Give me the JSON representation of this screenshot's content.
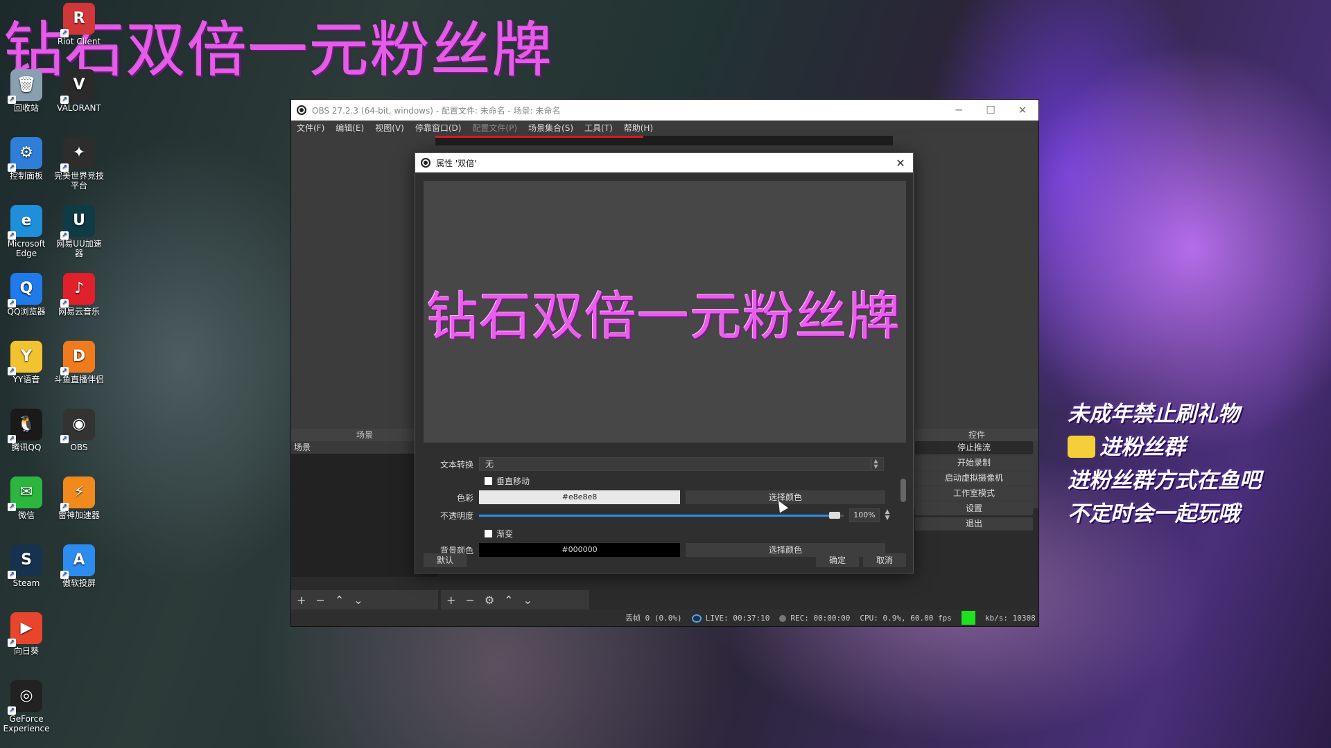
{
  "overlay_title": "钻石双倍一元粉丝牌",
  "desktop": {
    "icons": [
      {
        "label": "Riot Client",
        "icon": "riot-client-icon",
        "color": "#d13639",
        "glyph": "R"
      },
      {
        "label": "回收站",
        "icon": "recycle-bin-icon",
        "color": "#8aa0b0",
        "glyph": "🗑"
      },
      {
        "label": "VALORANT",
        "icon": "valorant-icon",
        "color": "#2a2a2a",
        "glyph": "V"
      },
      {
        "label": "控制面板",
        "icon": "control-panel-icon",
        "color": "#2f7fd8",
        "glyph": "⚙"
      },
      {
        "label": "完美世界竞技平台",
        "icon": "perfect-world-icon",
        "color": "#2d2d2d",
        "glyph": "✦"
      },
      {
        "label": "Microsoft Edge",
        "icon": "edge-icon",
        "color": "#1e8fd8",
        "glyph": "e"
      },
      {
        "label": "网易UU加速器",
        "icon": "uu-accelerator-icon",
        "color": "#0f3b45",
        "glyph": "U"
      },
      {
        "label": "QQ浏览器",
        "icon": "qq-browser-icon",
        "color": "#1f7bea",
        "glyph": "Q"
      },
      {
        "label": "网易云音乐",
        "icon": "netease-music-icon",
        "color": "#e0202b",
        "glyph": "♪"
      },
      {
        "label": "YY语音",
        "icon": "yy-voice-icon",
        "color": "#f2c230",
        "glyph": "Y"
      },
      {
        "label": "斗鱼直播伴侣",
        "icon": "douyu-icon",
        "color": "#f07b1f",
        "glyph": "D"
      },
      {
        "label": "腾讯QQ",
        "icon": "tencent-qq-icon",
        "color": "#1a1a1a",
        "glyph": "🐧"
      },
      {
        "label": "OBS",
        "icon": "obs-icon",
        "color": "#333333",
        "glyph": "◉"
      },
      {
        "label": "微信",
        "icon": "wechat-icon",
        "color": "#2cb53f",
        "glyph": "✉"
      },
      {
        "label": "雷神加速器",
        "icon": "leishen-accelerator-icon",
        "color": "#f08a1c",
        "glyph": "⚡"
      },
      {
        "label": "Steam",
        "icon": "steam-icon",
        "color": "#16324f",
        "glyph": "S"
      },
      {
        "label": "傲软投屏",
        "icon": "apowermirror-icon",
        "color": "#2d8cf0",
        "glyph": "A"
      },
      {
        "label": "向日葵",
        "icon": "sunlogin-icon",
        "color": "#e8452c",
        "glyph": "▶"
      },
      {
        "label": "GeForce Experience",
        "icon": "geforce-icon",
        "color": "#222",
        "glyph": "◎"
      }
    ]
  },
  "promo_lines": [
    "未成年禁止刷礼物",
    "进粉丝群",
    "进粉丝群方式在鱼吧",
    "不定时会一起玩哦"
  ],
  "obs": {
    "title": "OBS 27.2.3 (64-bit, windows) - 配置文件: 未命名 - 场景: 未命名",
    "menu": [
      "文件(F)",
      "编辑(E)",
      "视图(V)",
      "停靠窗口(D)",
      "配置文件(P)",
      "场景集合(S)",
      "工具(T)",
      "帮助(H)"
    ],
    "source_name": "双倍",
    "scenes_header": "场景",
    "scene_item": "场景",
    "controls_header": "控件",
    "controls": [
      "停止推流",
      "开始录制",
      "启动虚拟摄像机",
      "工作室模式",
      "设置",
      "退出"
    ],
    "status": {
      "dropped": "丢帧 0 (0.0%)",
      "live": "LIVE: 00:37:10",
      "rec": "REC: 00:00:00",
      "cpu": "CPU: 0.9%, 60.00 fps",
      "kbs": "kb/s: 10308"
    }
  },
  "dialog": {
    "title": "属性 '双倍'",
    "preview_text": "钻石双倍一元粉丝牌",
    "text_transform_label": "文本转换",
    "text_transform_value": "无",
    "vertical_scroll_label": "垂直移动",
    "color_label": "色彩",
    "color_value": "#e8e8e8",
    "pick_color": "选择颜色",
    "opacity_label": "不透明度",
    "opacity_value": "100%",
    "opacity_fraction": 0.99,
    "gradient_label": "渐变",
    "bg_color_label": "背景颜色",
    "bg_color_value": "#000000",
    "pick_bg_color": "选择颜色",
    "defaults_button": "默认",
    "ok_button": "确定",
    "cancel_button": "取消"
  }
}
